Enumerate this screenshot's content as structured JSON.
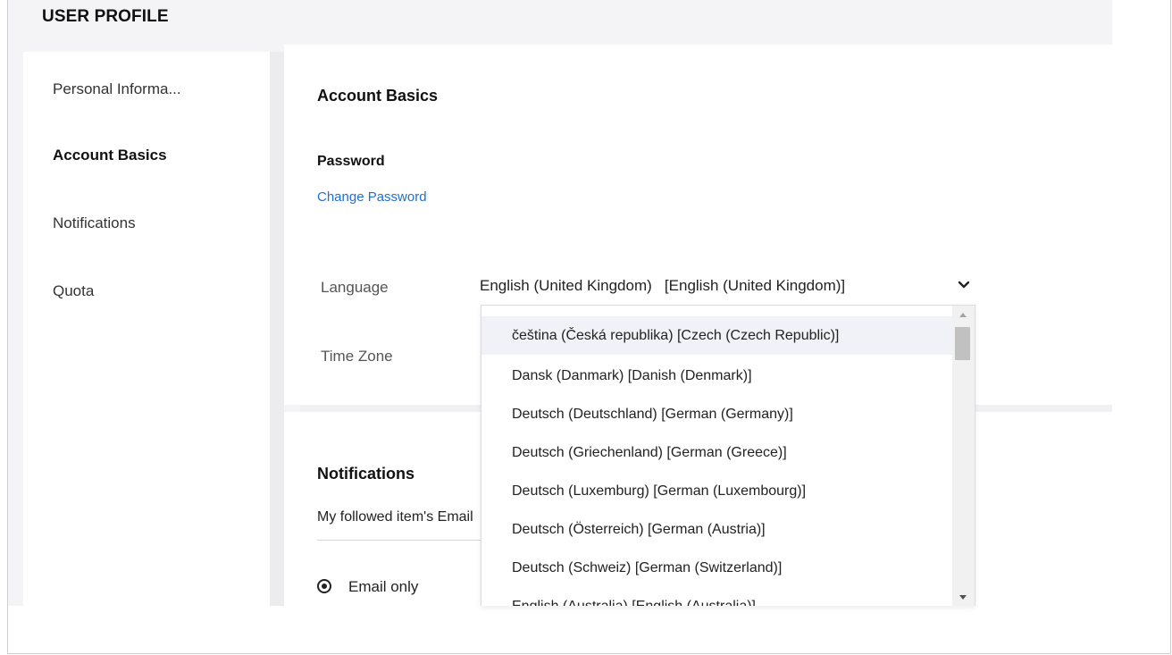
{
  "header": {
    "title": "USER PROFILE"
  },
  "sidebar": {
    "items": [
      {
        "label": "Personal Informa...",
        "active": false
      },
      {
        "label": "Account Basics",
        "active": true
      },
      {
        "label": "Notifications",
        "active": false
      },
      {
        "label": "Quota",
        "active": false
      }
    ]
  },
  "account": {
    "heading": "Account Basics",
    "password_label": "Password",
    "change_password_link": "Change Password",
    "language_label": "Language",
    "language_value": "English (United Kingdom)   [English (United Kingdom)]",
    "timezone_label": "Time Zone"
  },
  "language_dropdown": {
    "options": [
      "čeština (Česká republika) [Czech (Czech Republic)]",
      "Dansk (Danmark) [Danish (Denmark)]",
      "Deutsch (Deutschland) [German (Germany)]",
      "Deutsch (Griechenland) [German (Greece)]",
      "Deutsch (Luxemburg) [German (Luxembourg)]",
      "Deutsch (Österreich) [German (Austria)]",
      "Deutsch (Schweiz) [German (Switzerland)]",
      "English (Australia) [English (Australia)]"
    ],
    "highlighted_index": 0
  },
  "notifications": {
    "heading": "Notifications",
    "field_value": "My followed item's Email",
    "radio_selected_label": "Email only"
  },
  "colors": {
    "link": "#1f6fcf",
    "header_bg": "#f4f4f6",
    "highlight": "#f0f2f7"
  },
  "icons": {
    "dropdown_chevron": "chevron-down-icon",
    "scroll_up": "scroll-up-arrow-icon",
    "scroll_down": "scroll-down-arrow-icon"
  }
}
